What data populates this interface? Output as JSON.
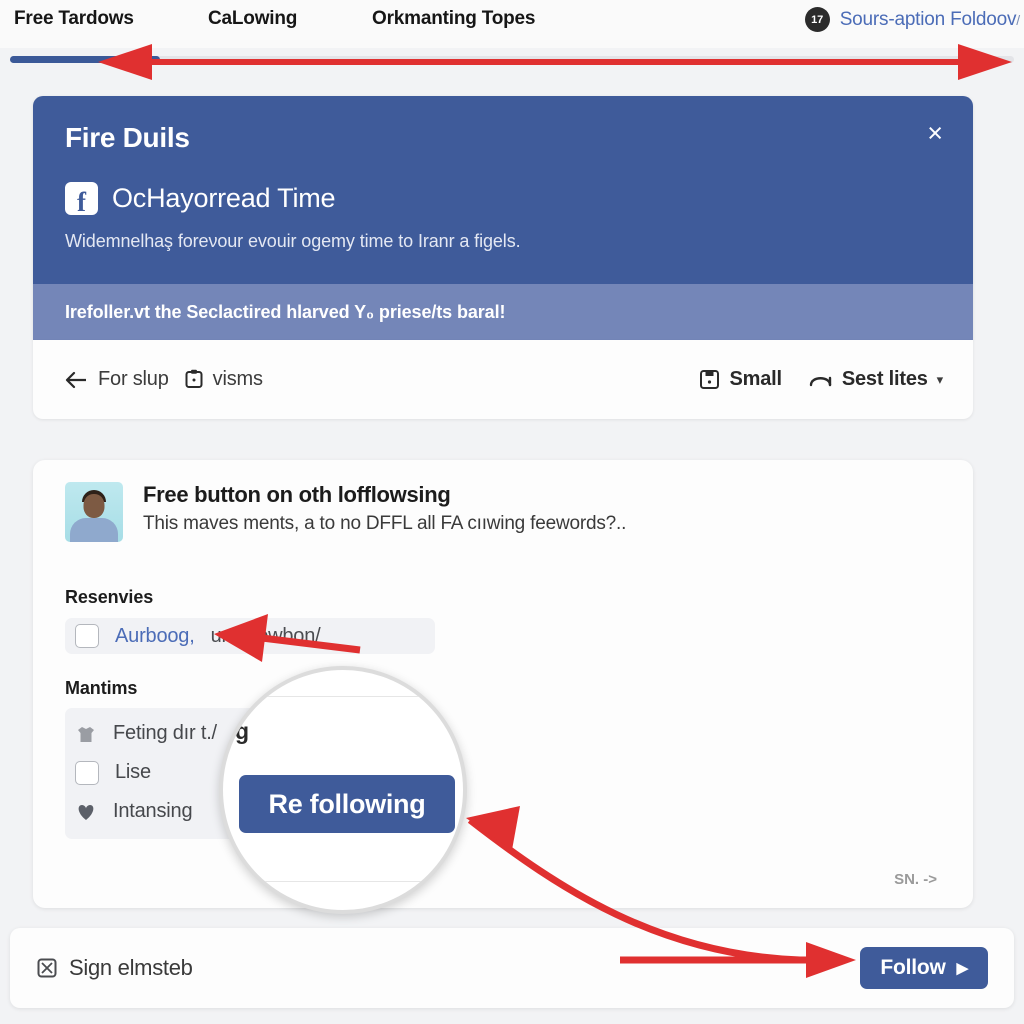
{
  "topnav": {
    "items": [
      {
        "label": "Free Tardows"
      },
      {
        "label": "CaLowing"
      },
      {
        "label": "Orkmanting Topes"
      }
    ],
    "badge_count": "17",
    "right_link": "Sours-aption Foldoov",
    "right_link_suffix": "/"
  },
  "progress": {
    "fill_color": "#3b5998",
    "track_color": "#e3e4e8"
  },
  "blue_card": {
    "title": "Fire Duils",
    "close_label": "×",
    "brand_icon": "facebook-icon",
    "brand_glyph": "f",
    "brand_name": "OcHayorread Time",
    "subtitle": "Widemnelhaş foreνour evouir ogemy time to Iranr a fiɡels.",
    "notice": "Irefoller.vt the Seclactired hlarved Y₀ priese/ts baral!",
    "bg_color": "#3f5b9a",
    "notice_bg_color": "#7486b8"
  },
  "toolbar": {
    "back_icon": "back-arrow-icon",
    "back_label": "For slup",
    "clipboard_icon": "clipboard-icon",
    "clipboard_label": "visms",
    "small_icon": "save-disk-icon",
    "small_label": "Small",
    "link_icon": "link-icon",
    "link_label": "Sest lites",
    "chevron_icon": "chevron-down-icon",
    "chevron_glyph": "▾"
  },
  "main_card": {
    "avatar_alt": "user-avatar",
    "post_title": "Free button on oth lofflowsing",
    "post_body": "This maves ments, a to no DFFL all FA cııwing feewords?..",
    "reserve_label": "Resenvies",
    "reserve_link": "Aurboog,",
    "reserve_link_tail": "unfollowbon/",
    "mantims_label": "Mantims",
    "mantims_items": [
      {
        "icon": "shirt-icon",
        "glyph": "♟",
        "label": "Feting dır t./"
      },
      {
        "icon": "checkbox-icon",
        "glyph": "",
        "label": "Lise"
      },
      {
        "icon": "heart-icon",
        "glyph": "♥",
        "label": "Intansing"
      }
    ],
    "footer_note": "SN. ->"
  },
  "magnifier": {
    "glyph_text": "ɡ",
    "button_label": "Re following",
    "button_color": "#3f5b9a"
  },
  "bottombar": {
    "sign_icon": "signature-icon",
    "sign_label": "Sign elmsteb",
    "follow_label": "Follow",
    "follow_caret": "▶",
    "follow_color": "#3f5b9a"
  },
  "annotations": {
    "arrow_color": "#e03030"
  }
}
